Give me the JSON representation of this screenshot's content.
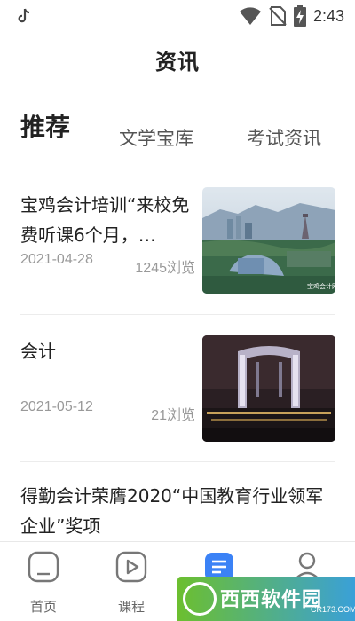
{
  "status_bar": {
    "time": "2:43",
    "icons": [
      "tiktok-icon",
      "wifi-icon",
      "no-sim-icon",
      "battery-charging-icon"
    ]
  },
  "header": {
    "title": "资讯"
  },
  "tabs": [
    {
      "label": "推荐",
      "active": true
    },
    {
      "label": "文学宝库",
      "active": false
    },
    {
      "label": "考试资讯",
      "active": false
    }
  ],
  "articles": [
    {
      "title": "宝鸡会计培训“来校免费听课6个月，…",
      "date": "2021-04-28",
      "views": "1245浏览",
      "thumbnail_icon": "city-landscape-image",
      "thumbnail_badge": "宝鸡会计网"
    },
    {
      "title": "会计",
      "date": "2021-05-12",
      "views": "21浏览",
      "thumbnail_icon": "night-gate-building-image"
    },
    {
      "title": "得勤会计荣膺2020“中国教育行业领军企业”奖项"
    }
  ],
  "bottom_nav": [
    {
      "label": "首页",
      "icon": "home-icon",
      "active": false
    },
    {
      "label": "课程",
      "icon": "play-icon",
      "active": false
    },
    {
      "label": "资讯",
      "icon": "news-list-icon",
      "active": true
    },
    {
      "label": "我的",
      "icon": "user-icon",
      "active": false
    }
  ],
  "watermark": {
    "text": "西西软件园",
    "sub": "CR173.COM"
  },
  "colors": {
    "accent": "#3b82f6",
    "text": "#222222",
    "muted": "#999999"
  }
}
